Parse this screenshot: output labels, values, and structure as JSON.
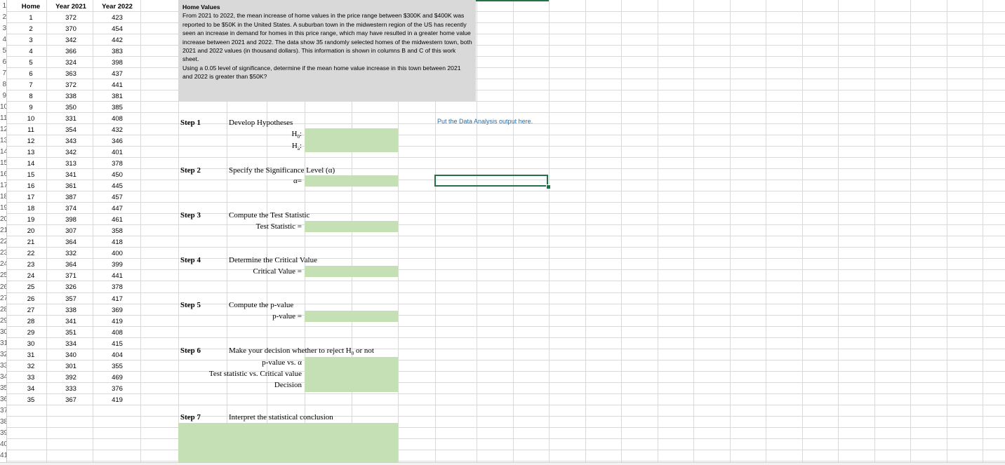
{
  "row_numbers": [
    "1",
    "2",
    "3",
    "4",
    "5",
    "6",
    "7",
    "8",
    "9",
    "10",
    "11",
    "12",
    "13",
    "14",
    "15",
    "16",
    "17",
    "18",
    "19",
    "20",
    "21",
    "22",
    "23",
    "24",
    "25",
    "26",
    "27",
    "28",
    "29",
    "30",
    "31",
    "32",
    "33",
    "34",
    "35",
    "36",
    "37",
    "38",
    "39",
    "40",
    "41",
    "42"
  ],
  "table": {
    "headers": [
      "Home",
      "Year 2021",
      "Year 2022"
    ],
    "rows": [
      [
        "1",
        "372",
        "423"
      ],
      [
        "2",
        "370",
        "454"
      ],
      [
        "3",
        "342",
        "442"
      ],
      [
        "4",
        "366",
        "383"
      ],
      [
        "5",
        "324",
        "398"
      ],
      [
        "6",
        "363",
        "437"
      ],
      [
        "7",
        "372",
        "441"
      ],
      [
        "8",
        "338",
        "381"
      ],
      [
        "9",
        "350",
        "385"
      ],
      [
        "10",
        "331",
        "408"
      ],
      [
        "11",
        "354",
        "432"
      ],
      [
        "12",
        "343",
        "346"
      ],
      [
        "13",
        "342",
        "401"
      ],
      [
        "14",
        "313",
        "378"
      ],
      [
        "15",
        "341",
        "450"
      ],
      [
        "16",
        "361",
        "445"
      ],
      [
        "17",
        "387",
        "457"
      ],
      [
        "18",
        "374",
        "447"
      ],
      [
        "19",
        "398",
        "461"
      ],
      [
        "20",
        "307",
        "358"
      ],
      [
        "21",
        "364",
        "418"
      ],
      [
        "22",
        "332",
        "400"
      ],
      [
        "23",
        "364",
        "399"
      ],
      [
        "24",
        "371",
        "441"
      ],
      [
        "25",
        "326",
        "378"
      ],
      [
        "26",
        "357",
        "417"
      ],
      [
        "27",
        "338",
        "369"
      ],
      [
        "28",
        "341",
        "419"
      ],
      [
        "29",
        "351",
        "408"
      ],
      [
        "30",
        "334",
        "415"
      ],
      [
        "31",
        "340",
        "404"
      ],
      [
        "32",
        "301",
        "355"
      ],
      [
        "33",
        "392",
        "469"
      ],
      [
        "34",
        "333",
        "376"
      ],
      [
        "35",
        "367",
        "419"
      ]
    ]
  },
  "textbox": {
    "title": "Home Values",
    "paragraph1": "From 2021 to 2022, the mean increase of home values in the price range between $300K and $400K was reported to be $50K in the United States. A suburban town in the midwestern region of the US has recently seen an increase in demand for homes in this price range, which may have resulted in a greater home value increase between 2021 and 2022. The data show 35 randomly selected homes of the midwestern town, both 2021 and 2022 values (in thousand dollars). This information is shown in columns B and C of this work sheet.",
    "paragraph2": "Using a 0.05 level of significance, determine if the mean home value increase in this town between 2021 and 2022 is greater than $50K?"
  },
  "steps": {
    "s1": {
      "label": "Step 1",
      "title": "Develop Hypotheses",
      "h0": "H",
      "h0_sub": "0",
      "h0_colon": ":",
      "ha": "H",
      "ha_sub": "a",
      "ha_colon": ":"
    },
    "s2": {
      "label": "Step 2",
      "title": "Specify the Significance Level (α)",
      "alpha": "α="
    },
    "s3": {
      "label": "Step 3",
      "title": "Compute the Test Statistic",
      "field": "Test Statistic ="
    },
    "s4": {
      "label": "Step 4",
      "title": "Determine the Critical Value",
      "field": "Critical Value ="
    },
    "s5": {
      "label": "Step 5",
      "title": "Compute the p-value",
      "field": "p-value ="
    },
    "s6": {
      "label": "Step 6",
      "title_a": "Make your decision whether to reject H",
      "title_sub": "0",
      "title_b": " or not",
      "f1": "p-value vs. α",
      "f2": "Test statistic vs. Critical value",
      "f3": "Decision"
    },
    "s7": {
      "label": "Step 7",
      "title": "Interpret the statistical conclusion"
    }
  },
  "note": "Put the Data Analysis output here.",
  "colors": {
    "input_green": "#c5e0b4",
    "textbox_gray": "#d9d9d9",
    "excel_green": "#217346",
    "note_blue": "#1f6fb4"
  }
}
